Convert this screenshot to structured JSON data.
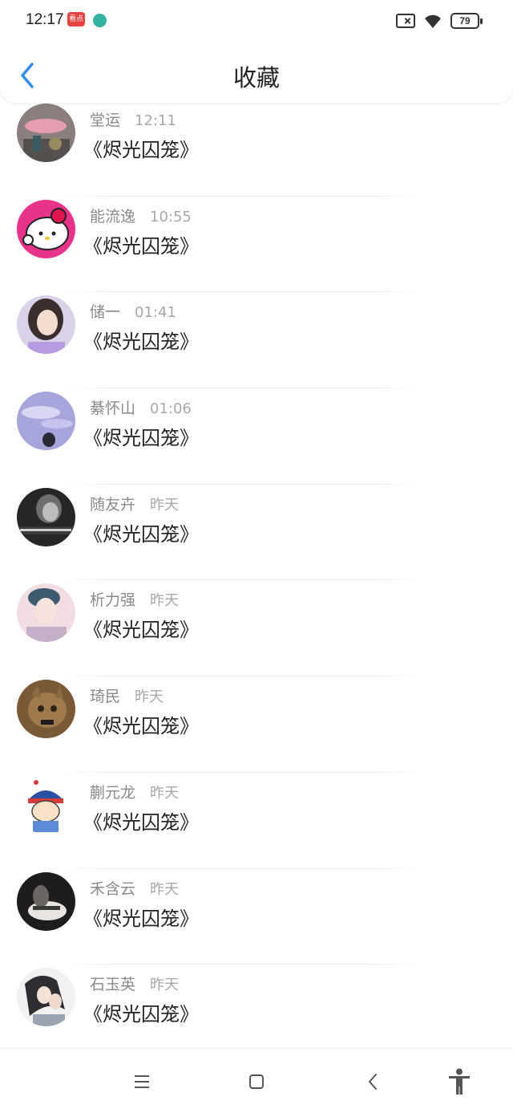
{
  "status_bar": {
    "time": "12:17",
    "app_badge": "看点",
    "battery": "79"
  },
  "header": {
    "title": "收藏"
  },
  "items": [
    {
      "name": "堂运",
      "time": "12:11",
      "message": "《烬光囚笼》"
    },
    {
      "name": "能流逸",
      "time": "10:55",
      "message": "《烬光囚笼》"
    },
    {
      "name": "储一",
      "time": "01:41",
      "message": "《烬光囚笼》"
    },
    {
      "name": "綦怀山",
      "time": "01:06",
      "message": "《烬光囚笼》"
    },
    {
      "name": "随友卉",
      "time": "昨天",
      "message": "《烬光囚笼》"
    },
    {
      "name": "析力强",
      "time": "昨天",
      "message": "《烬光囚笼》"
    },
    {
      "name": "琦民",
      "time": "昨天",
      "message": "《烬光囚笼》"
    },
    {
      "name": "蒯元龙",
      "time": "昨天",
      "message": "《烬光囚笼》"
    },
    {
      "name": "禾含云",
      "time": "昨天",
      "message": "《烬光囚笼》"
    },
    {
      "name": "石玉英",
      "time": "昨天",
      "message": "《烬光囚笼》"
    }
  ],
  "colors": {
    "accent": "#2f8ef0",
    "text_primary": "#222222",
    "text_secondary": "#8a8a8a"
  },
  "nav": {
    "icons": [
      "menu-icon",
      "home-icon",
      "back-icon",
      "accessibility-icon"
    ]
  }
}
